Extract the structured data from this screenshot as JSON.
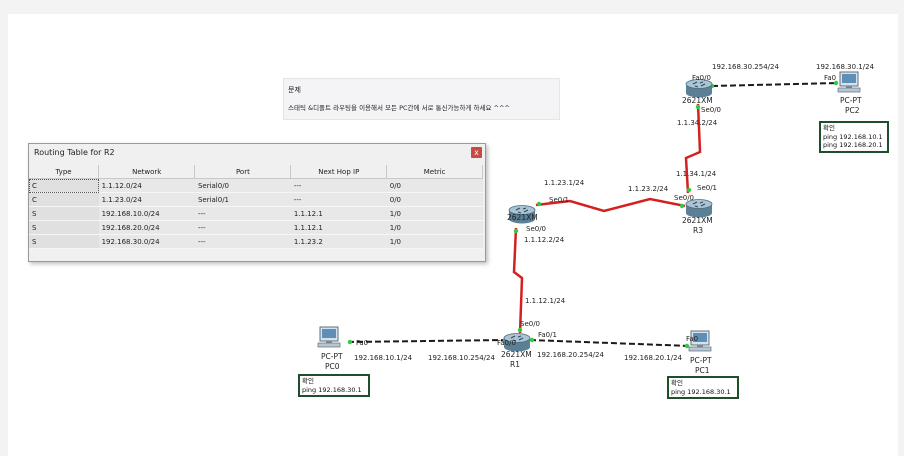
{
  "note": {
    "title": "문제",
    "body": "스태틱 &디폴트 라우팅을 이용해서 모든 PC간에 서로 통신가능하게 하세요 ^^^"
  },
  "routing_window": {
    "title": "Routing Table for R2",
    "close_label": "x",
    "columns": [
      "Type",
      "Network",
      "Port",
      "Next Hop IP",
      "Metric"
    ],
    "rows": [
      [
        "C",
        "1.1.12.0/24",
        "Serial0/0",
        "---",
        "0/0"
      ],
      [
        "C",
        "1.1.23.0/24",
        "Serial0/1",
        "---",
        "0/0"
      ],
      [
        "S",
        "192.168.10.0/24",
        "---",
        "1.1.12.1",
        "1/0"
      ],
      [
        "S",
        "192.168.20.0/24",
        "---",
        "1.1.12.1",
        "1/0"
      ],
      [
        "S",
        "192.168.30.0/24",
        "---",
        "1.1.23.2",
        "1/0"
      ]
    ]
  },
  "devices": {
    "r2": {
      "model": "2621XM"
    },
    "r3": {
      "model": "2621XM",
      "name": "R3"
    },
    "r4": {
      "model": "2621XM"
    },
    "r1": {
      "model": "2621XM",
      "name": "R1"
    },
    "pc0": {
      "type": "PC-PT",
      "name": "PC0"
    },
    "pc1": {
      "type": "PC-PT",
      "name": "PC1"
    },
    "pc2": {
      "type": "PC-PT",
      "name": "PC2"
    }
  },
  "labels": {
    "l_192_30_254": "192.168.30.254/24",
    "l_192_30_1": "192.168.30.1/24",
    "r4_fa00": "Fa0/0",
    "pc2_fa0": "Fa0",
    "r4_se00": "Se0/0",
    "l_1_34_2": "1.1.34.2/24",
    "l_1_34_1": "1.1.34.1/24",
    "r3_se01": "Se0/1",
    "l_1_23_1": "1.1.23.1/24",
    "l_1_23_2": "1.1.23.2/24",
    "r2_se01": "Se0/1",
    "r3_se00": "Se0/0",
    "r2_se00": "Se0/0",
    "l_1_12_2": "1.1.12.2/24",
    "l_1_12_1": "1.1.12.1/24",
    "r1_se00": "Se0/0",
    "r1_fa00": "Fa0/0",
    "r1_fa01": "Fa0/1",
    "pc0_fa0": "Fa0",
    "pc1_fa0": "Fa0",
    "l_192_10_1": "192.168.10.1/24",
    "l_192_10_254": "192.168.10.254/24",
    "l_192_20_254": "192.168.20.254/24",
    "l_192_20_1": "192.168.20.1/24"
  },
  "notes": {
    "pc0": {
      "title": "확인",
      "lines": [
        "ping 192.168.30.1"
      ]
    },
    "pc1": {
      "title": "확인",
      "lines": [
        "ping 192.168.30.1"
      ]
    },
    "pc2": {
      "title": "확인",
      "lines": [
        "ping 192.168.10.1",
        "ping 192.168.20.1"
      ]
    }
  },
  "colors": {
    "serial_link": "#d42020",
    "ethernet_link": "#1a1a1a",
    "link_up": "#2ecc40",
    "note_border": "#1c4f2a"
  },
  "icons": {
    "router": "router-icon",
    "pc": "pc-icon"
  }
}
